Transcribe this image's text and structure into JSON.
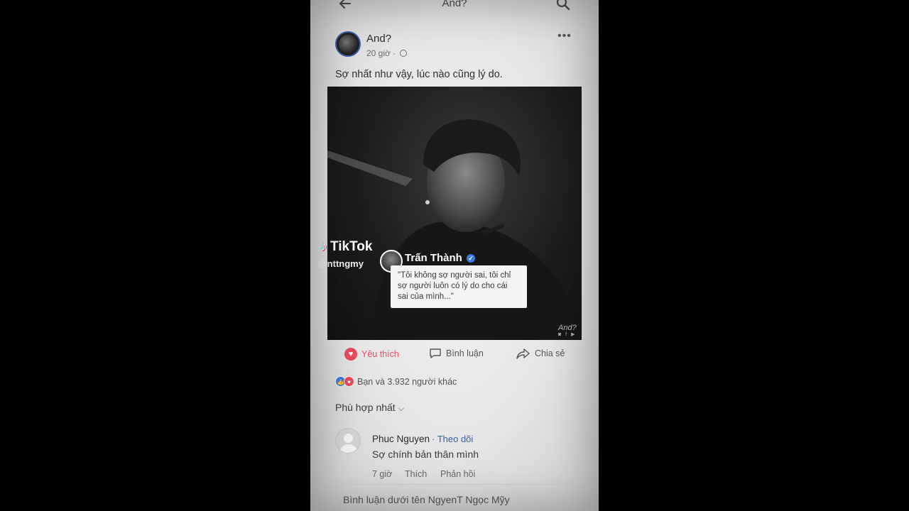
{
  "header": {
    "title": "And?",
    "back_icon": "back-arrow-icon",
    "search_icon": "search-icon"
  },
  "post": {
    "author": "And?",
    "time": "20 giờ ·",
    "caption": "Sợ nhất như vậy, lúc nào cũng lý do.",
    "image": {
      "tiktok_label": "TikTok",
      "tiktok_user": "@nttngmy",
      "quote_author": "Trấn Thành",
      "quote_text": "\"Tôi không sợ người sai, tôi chỉ sợ người luôn có lý do cho cái sai của mình...\"",
      "watermark": "And?"
    }
  },
  "actions": {
    "like": "Yêu thích",
    "comment": "Bình luận",
    "share": "Chia sẻ"
  },
  "reactions_text": "Bạn và 3.932 người khác",
  "sort_label": "Phù hợp nhất",
  "comment": {
    "name": "Phuc Nguyen",
    "follow": "· Theo dõi",
    "text": "Sợ chính bản thân mình",
    "time": "7 giờ",
    "like": "Thích",
    "reply": "Phản hồi"
  },
  "comment_input_placeholder": "Bình luận dưới tên NgyenT Ngọc Mỹy",
  "colors": {
    "accent_blue": "#3b5ea8",
    "love_red": "#e84b5c"
  }
}
